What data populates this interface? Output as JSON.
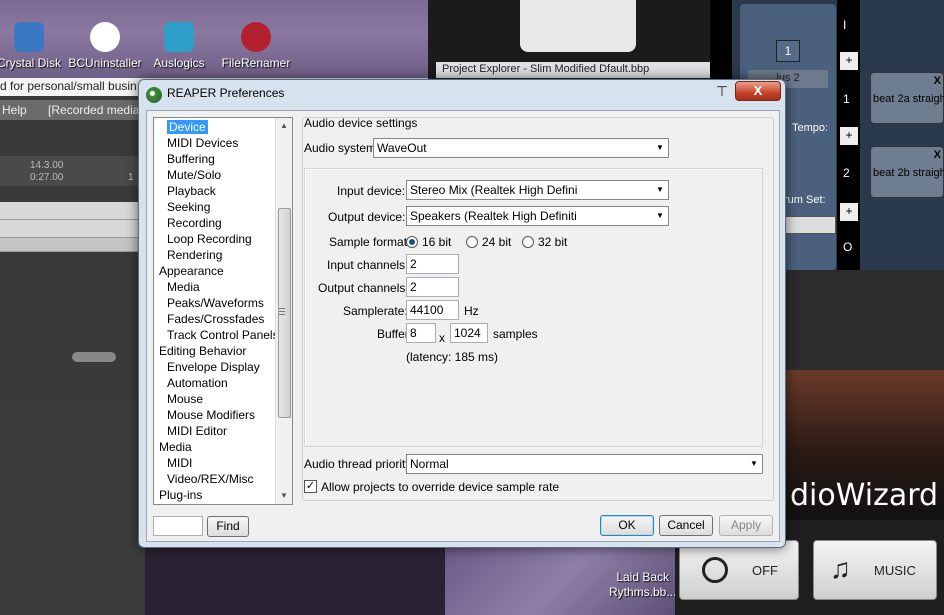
{
  "desktop": {
    "icons": [
      {
        "label": "Crystal Disk",
        "color": "#3a78c2"
      },
      {
        "label": "BCUninstaller",
        "color": "#ffffff"
      },
      {
        "label": "Auslogics",
        "color": "#2e9fc9"
      },
      {
        "label": "FileRenamer",
        "color": "#b3212e"
      }
    ],
    "banner_text": "d for personal/small busin",
    "menu": {
      "help": "Help",
      "recorded": "[Recorded media"
    },
    "ruler": {
      "a": "14.3.00",
      "b": "0:27.00",
      "c": "1"
    },
    "project_title": "Project Explorer - Slim Modified Dfault.bbp",
    "bb": {
      "num1": "1",
      "num2": "1",
      "num3": "2",
      "i_label": "I",
      "o_label": "O",
      "plus": "+",
      "slot1": "beat 2a straigh",
      "slot2": "beat 2b straigh",
      "tempo": "Tempo:",
      "drum_set": "rum Set:",
      "plus2": "lus 2",
      "x": "X"
    },
    "wizard_title": "dioWizard",
    "laid_back": "Laid Back",
    "rhythms": "Rythms.bb...",
    "off_label": "OFF",
    "music_label": "MUSIC"
  },
  "dialog": {
    "title": "REAPER Preferences",
    "close": "X",
    "tree": [
      {
        "label": "Device",
        "level": 1,
        "selected": true
      },
      {
        "label": "MIDI Devices",
        "level": 1
      },
      {
        "label": "Buffering",
        "level": 1
      },
      {
        "label": "Mute/Solo",
        "level": 1
      },
      {
        "label": "Playback",
        "level": 1
      },
      {
        "label": "Seeking",
        "level": 1
      },
      {
        "label": "Recording",
        "level": 1
      },
      {
        "label": "Loop Recording",
        "level": 1
      },
      {
        "label": "Rendering",
        "level": 1
      },
      {
        "label": "Appearance",
        "level": 0
      },
      {
        "label": "Media",
        "level": 1
      },
      {
        "label": "Peaks/Waveforms",
        "level": 1
      },
      {
        "label": "Fades/Crossfades",
        "level": 1
      },
      {
        "label": "Track Control Panels",
        "level": 1
      },
      {
        "label": "Editing Behavior",
        "level": 0
      },
      {
        "label": "Envelope Display",
        "level": 1
      },
      {
        "label": "Automation",
        "level": 1
      },
      {
        "label": "Mouse",
        "level": 1
      },
      {
        "label": "Mouse Modifiers",
        "level": 1
      },
      {
        "label": "MIDI Editor",
        "level": 1
      },
      {
        "label": "Media",
        "level": 0
      },
      {
        "label": "MIDI",
        "level": 1
      },
      {
        "label": "Video/REX/Misc",
        "level": 1
      },
      {
        "label": "Plug-ins",
        "level": 0
      }
    ],
    "find_button": "Find",
    "find_value": "",
    "section_title": "Audio device settings",
    "audio_system_label": "Audio system:",
    "audio_system_value": "WaveOut",
    "input_device_label": "Input device:",
    "input_device_value": "Stereo Mix (Realtek High Defini",
    "output_device_label": "Output device:",
    "output_device_value": "Speakers (Realtek High Definiti",
    "sample_format_label": "Sample format:",
    "format_16": "16 bit",
    "format_24": "24 bit",
    "format_32": "32 bit",
    "selected_format": "16 bit",
    "input_channels_label": "Input channels:",
    "input_channels_value": "2",
    "output_channels_label": "Output channels:",
    "output_channels_value": "2",
    "samplerate_label": "Samplerate:",
    "samplerate_value": "44100",
    "samplerate_unit": "Hz",
    "buffers_label": "Buffers:",
    "buffers_count": "8",
    "buffers_x": "x",
    "buffers_size": "1024",
    "buffers_unit": "samples",
    "latency": "(latency: 185 ms)",
    "thread_priority_label": "Audio thread priority:",
    "thread_priority_value": "Normal",
    "allow_override_label": "Allow projects to override device sample rate",
    "allow_override_checked": true,
    "ok": "OK",
    "cancel": "Cancel",
    "apply": "Apply"
  }
}
